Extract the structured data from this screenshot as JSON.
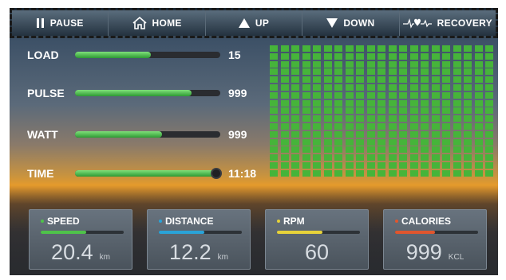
{
  "toolbar": {
    "pause": "PAUSE",
    "home": "HOME",
    "up": "UP",
    "down": "DOWN",
    "recovery": "RECOVERY"
  },
  "metrics": [
    {
      "label": "LOAD",
      "value": "15",
      "fill_pct": 52
    },
    {
      "label": "PULSE",
      "value": "999",
      "fill_pct": 80
    },
    {
      "label": "WATT",
      "value": "999",
      "fill_pct": 60
    },
    {
      "label": "TIME",
      "value": "11:18",
      "fill_pct": 96
    }
  ],
  "cards": [
    {
      "label": "SPEED",
      "value": "20.4",
      "unit": "km",
      "fill_pct": 55,
      "color": "#4fc24a"
    },
    {
      "label": "DISTANCE",
      "value": "12.2",
      "unit": "km",
      "fill_pct": 55,
      "color": "#2aa3d8"
    },
    {
      "label": "RPM",
      "value": "60",
      "unit": "",
      "fill_pct": 55,
      "color": "#e6d23a"
    },
    {
      "label": "CALORIES",
      "value": "999",
      "unit": "KCL",
      "fill_pct": 48,
      "color": "#e0562e"
    }
  ],
  "colors": {
    "led": "#46b43a",
    "bar": "#4fc24a"
  }
}
